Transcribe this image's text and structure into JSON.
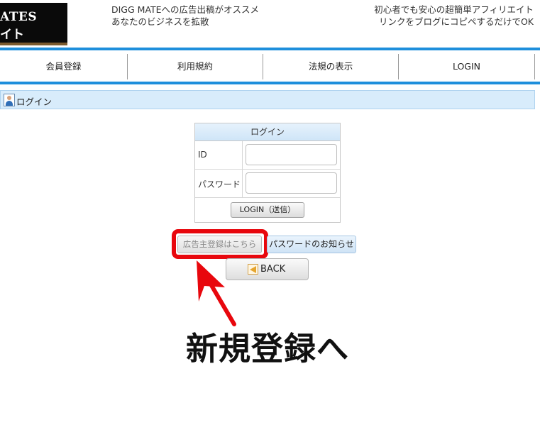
{
  "header": {
    "logo_line1": "ATES",
    "logo_line2": "イト",
    "left_line1": "DIGG MATEへの広告出稿がオススメ",
    "left_line2": "あなたのビジネスを拡散",
    "right_line1": "初心者でも安心の超簡単アフィリエイト",
    "right_line2": "リンクをブログにコピペするだけでOK"
  },
  "nav": {
    "items": [
      {
        "label": "会員登録"
      },
      {
        "label": "利用規約"
      },
      {
        "label": "法規の表示"
      },
      {
        "label": "LOGIN"
      }
    ]
  },
  "section": {
    "title": "ログイン",
    "icon": "person-icon"
  },
  "login_form": {
    "header": "ログイン",
    "id_label": "ID",
    "id_value": "",
    "password_label": "パスワード",
    "password_value": "",
    "submit_label": "LOGIN（送信）"
  },
  "actions": {
    "advertiser_register_label": "広告主登録はこちら",
    "password_notice_label": "パスワードのお知らせ",
    "back_label": "BACK"
  },
  "annotation": {
    "text": "新規登録へ",
    "highlight_color": "#e8070d",
    "arrow_color": "#e8070d"
  },
  "colors": {
    "accent": "#1e8fdc",
    "section_bg": "#d8ecfb"
  }
}
